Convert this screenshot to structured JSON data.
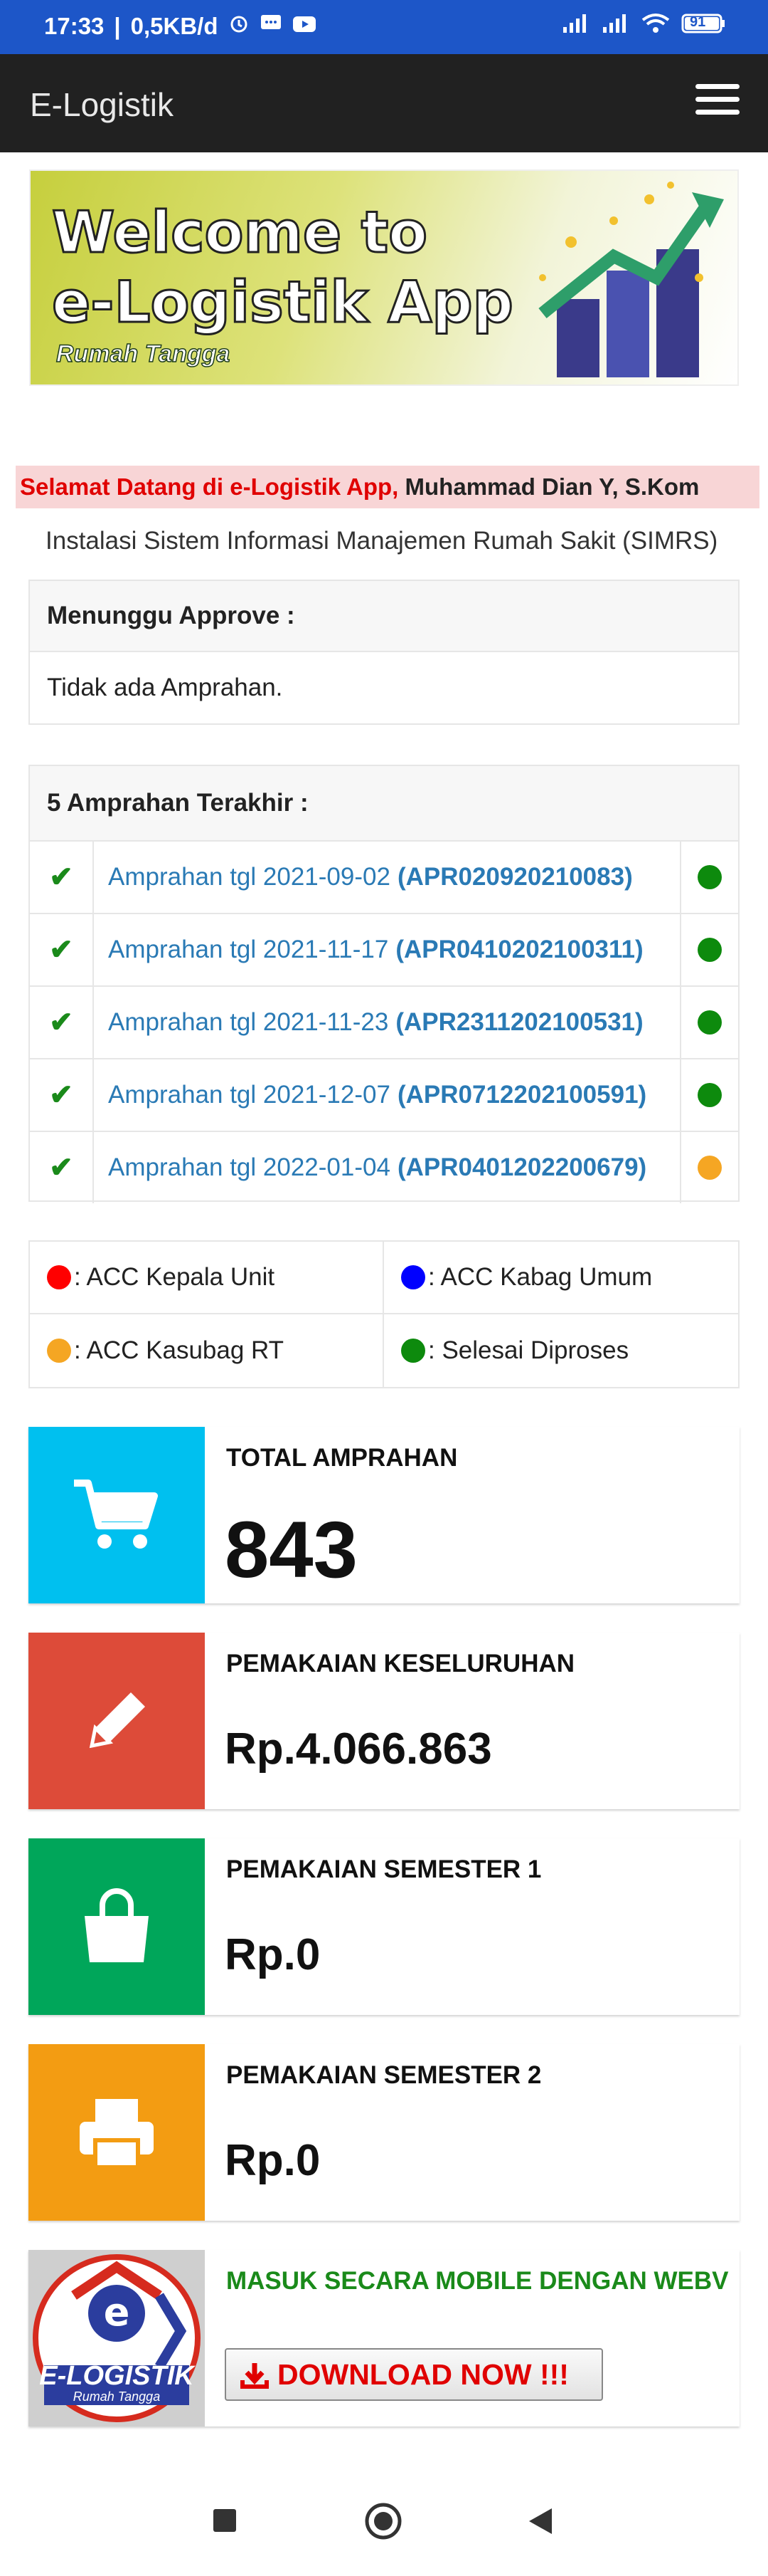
{
  "status_bar": {
    "time": "17:33",
    "speed": "0,5KB/d",
    "battery": "91"
  },
  "app": {
    "title": "E-Logistik"
  },
  "banner": {
    "line1": "Welcome to",
    "line2": "e-Logistik App",
    "line3": "Rumah Tangga"
  },
  "welcome": {
    "greeting": "Selamat Datang di e-Logistik App,",
    "user": "Muhammad Dian Y, S.Kom",
    "unit": "Instalasi Sistem Informasi Manajemen Rumah Sakit (SIMRS)"
  },
  "approve": {
    "title": "Menunggu Approve :",
    "empty_text": "Tidak ada Amprahan."
  },
  "recent": {
    "title": "5 Amprahan Terakhir :",
    "items": [
      {
        "text": "Amprahan tgl 2021-09-02",
        "code": "(APR020920210083)",
        "status_color": "#0d8a0d"
      },
      {
        "text": "Amprahan tgl 2021-11-17",
        "code": "(APR0410202100311)",
        "status_color": "#0d8a0d"
      },
      {
        "text": "Amprahan tgl 2021-11-23",
        "code": "(APR2311202100531)",
        "status_color": "#0d8a0d"
      },
      {
        "text": "Amprahan tgl 2021-12-07",
        "code": "(APR0712202100591)",
        "status_color": "#0d8a0d"
      },
      {
        "text": "Amprahan tgl 2022-01-04",
        "code": "(APR0401202200679)",
        "status_color": "#f5a623"
      }
    ]
  },
  "legend": {
    "items": [
      {
        "label": ": ACC Kepala Unit",
        "color": "#ff0000"
      },
      {
        "label": ": ACC Kabag Umum",
        "color": "#0000ff"
      },
      {
        "label": ": ACC Kasubag RT",
        "color": "#f5a623"
      },
      {
        "label": ": Selesai Diproses",
        "color": "#0d8a0d"
      }
    ]
  },
  "stats": {
    "total": {
      "label": "TOTAL AMPRAHAN",
      "value": "843",
      "color": "#00c0ef"
    },
    "all": {
      "label": "PEMAKAIAN KESELURUHAN",
      "value": "Rp.4.066.863",
      "color": "#dd4b39"
    },
    "sem1": {
      "label": "PEMAKAIAN SEMESTER 1",
      "value": "Rp.0",
      "color": "#00a65a"
    },
    "sem2": {
      "label": "PEMAKAIAN SEMESTER 2",
      "value": "Rp.0",
      "color": "#f39c12"
    }
  },
  "download": {
    "label": "MASUK SECARA MOBILE DENGAN WEBV",
    "button": "DOWNLOAD NOW !!!",
    "logo_text": "E-LOGISTIK",
    "logo_sub": "Rumah Tangga"
  }
}
